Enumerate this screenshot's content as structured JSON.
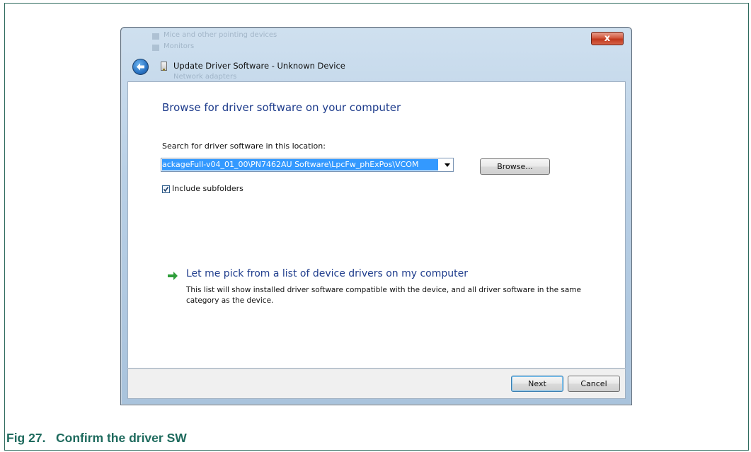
{
  "dialog": {
    "background_items": [
      "Mice and other pointing devices",
      "Monitors",
      "Network adapters"
    ],
    "close_label": "x",
    "title": "Update Driver Software - Unknown Device",
    "heading": "Browse for driver software on your computer",
    "search_label": "Search for driver software in this location:",
    "path_value": "ackageFull-v04_01_00\\PN7462AU Software\\LpcFw_phExPos\\VCOM",
    "browse_label": "Browse...",
    "include_subfolders_label": "Include subfolders",
    "include_subfolders_checked": true,
    "pick_title": "Let me pick from a list of device drivers on my computer",
    "pick_description": "This list will show installed driver software compatible with the device, and all driver software in the same category as the device.",
    "next_label": "Next",
    "cancel_label": "Cancel"
  },
  "caption": "Fig 27.   Confirm the driver SW",
  "colors": {
    "link_blue": "#1e3c8c",
    "selection": "#3399ff",
    "caption_green": "#1f6b5e"
  }
}
